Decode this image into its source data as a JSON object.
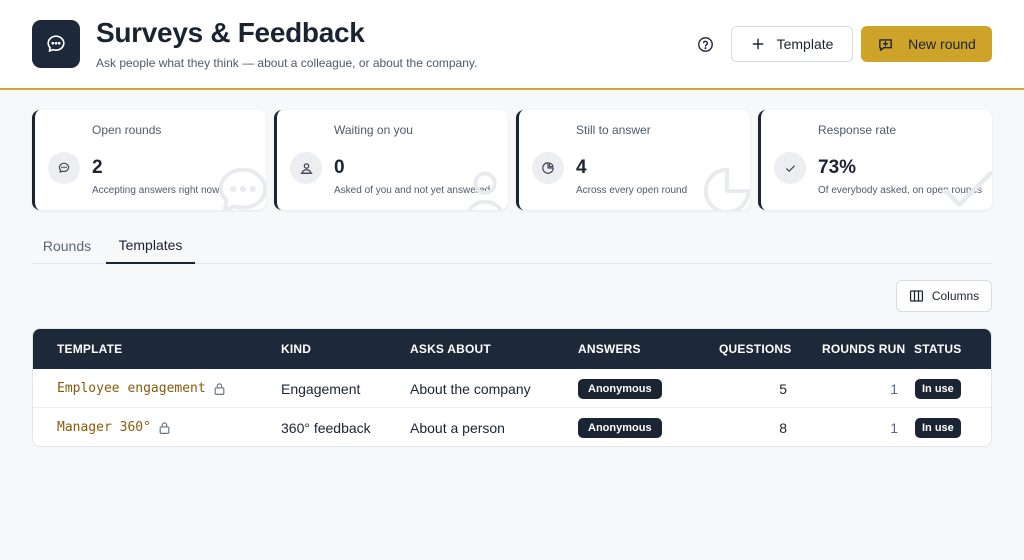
{
  "header": {
    "title": "Surveys & Feedback",
    "subtitle": "Ask people what they think — about a colleague, or about the company.",
    "template_label": "Template",
    "new_round_label": "New round"
  },
  "stats": [
    {
      "label": "Open rounds",
      "value": "2",
      "note": "Accepting answers right now",
      "icon": "chat-icon"
    },
    {
      "label": "Waiting on you",
      "value": "0",
      "note": "Asked of you and not yet answered",
      "icon": "person-icon"
    },
    {
      "label": "Still to answer",
      "value": "4",
      "note": "Across every open round",
      "icon": "pie-chart-icon"
    },
    {
      "label": "Response rate",
      "value": "73%",
      "note": "Of everybody asked, on open rounds",
      "icon": "check-icon"
    }
  ],
  "tabs": [
    {
      "label": "Rounds",
      "active": false
    },
    {
      "label": "Templates",
      "active": true
    }
  ],
  "columns_label": "Columns",
  "table": {
    "headers": [
      "TEMPLATE",
      "KIND",
      "ASKS ABOUT",
      "ANSWERS",
      "QUESTIONS",
      "ROUNDS RUN",
      "STATUS"
    ],
    "rows": [
      {
        "name": "Employee engagement",
        "kind": "Engagement",
        "asks_about": "About the company",
        "answers": "Anonymous",
        "questions": "5",
        "rounds_run": "1",
        "status": "In use"
      },
      {
        "name": "Manager 360°",
        "kind": "360° feedback",
        "asks_about": "About a person",
        "answers": "Anonymous",
        "questions": "8",
        "rounds_run": "1",
        "status": "In use"
      }
    ]
  },
  "colors": {
    "accent": "#cea329",
    "navy": "#1d2838",
    "template_name": "#8a5a0b"
  }
}
